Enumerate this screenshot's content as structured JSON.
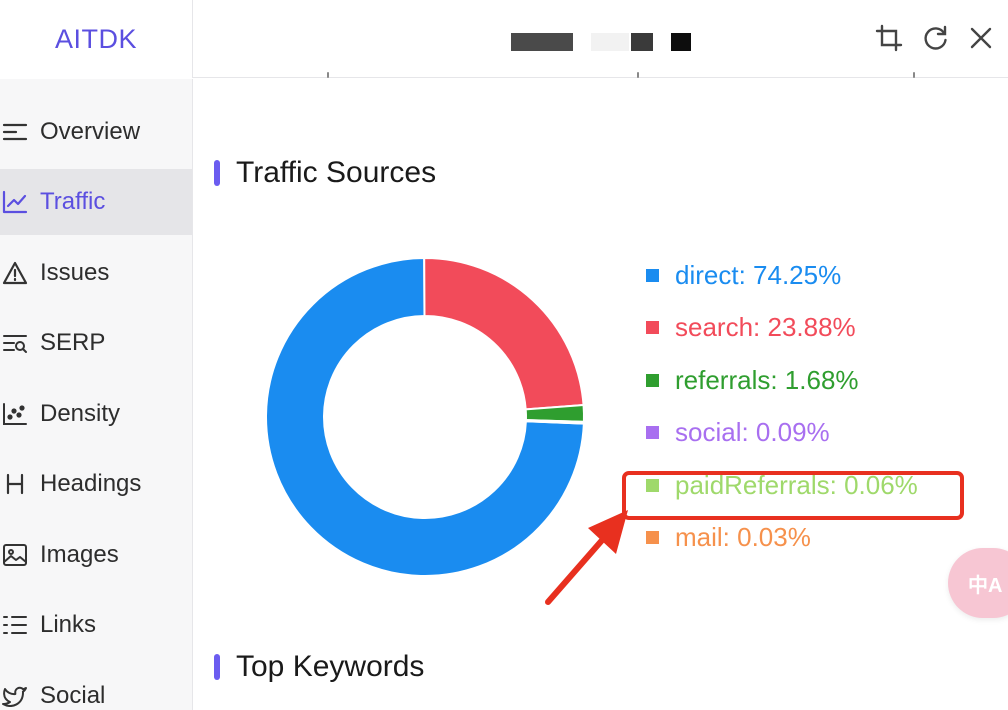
{
  "app": {
    "name": "AITDK"
  },
  "header": {
    "tools": [
      {
        "name": "crop-icon"
      },
      {
        "name": "refresh-icon"
      },
      {
        "name": "close-icon"
      }
    ]
  },
  "sidebar": {
    "items": [
      {
        "label": "Overview",
        "icon": "overview-lines-icon",
        "active": false
      },
      {
        "label": "Traffic",
        "icon": "line-chart-icon",
        "active": true
      },
      {
        "label": "Issues",
        "icon": "warning-icon",
        "active": false
      },
      {
        "label": "SERP",
        "icon": "serp-search-icon",
        "active": false
      },
      {
        "label": "Density",
        "icon": "scatter-icon",
        "active": false
      },
      {
        "label": "Headings",
        "icon": "heading-icon",
        "active": false
      },
      {
        "label": "Images",
        "icon": "image-icon",
        "active": false
      },
      {
        "label": "Links",
        "icon": "list-links-icon",
        "active": false
      },
      {
        "label": "Social",
        "icon": "twitter-icon",
        "active": false
      }
    ]
  },
  "main": {
    "traffic_sources_title": "Traffic Sources",
    "top_keywords_title": "Top Keywords"
  },
  "chart_data": {
    "type": "pie",
    "donut": true,
    "title": "Traffic Sources",
    "legend_position": "right",
    "series": [
      {
        "name": "direct",
        "value": 74.25,
        "label": "direct: 74.25%",
        "color": "#1a8cf0"
      },
      {
        "name": "search",
        "value": 23.88,
        "label": "search: 23.88%",
        "color": "#f24b5a"
      },
      {
        "name": "referrals",
        "value": 1.68,
        "label": "referrals: 1.68%",
        "color": "#2f9e2f"
      },
      {
        "name": "social",
        "value": 0.09,
        "label": "social: 0.09%",
        "color": "#a86ff0"
      },
      {
        "name": "paidReferrals",
        "value": 0.06,
        "label": "paidReferrals: 0.06%",
        "color": "#9fd96b"
      },
      {
        "name": "mail",
        "value": 0.03,
        "label": "mail: 0.03%",
        "color": "#f6914c"
      }
    ]
  },
  "annotation": {
    "highlighted_entry": "paidReferrals",
    "color": "#e8301f"
  },
  "translate_button": {
    "label": "中A"
  }
}
